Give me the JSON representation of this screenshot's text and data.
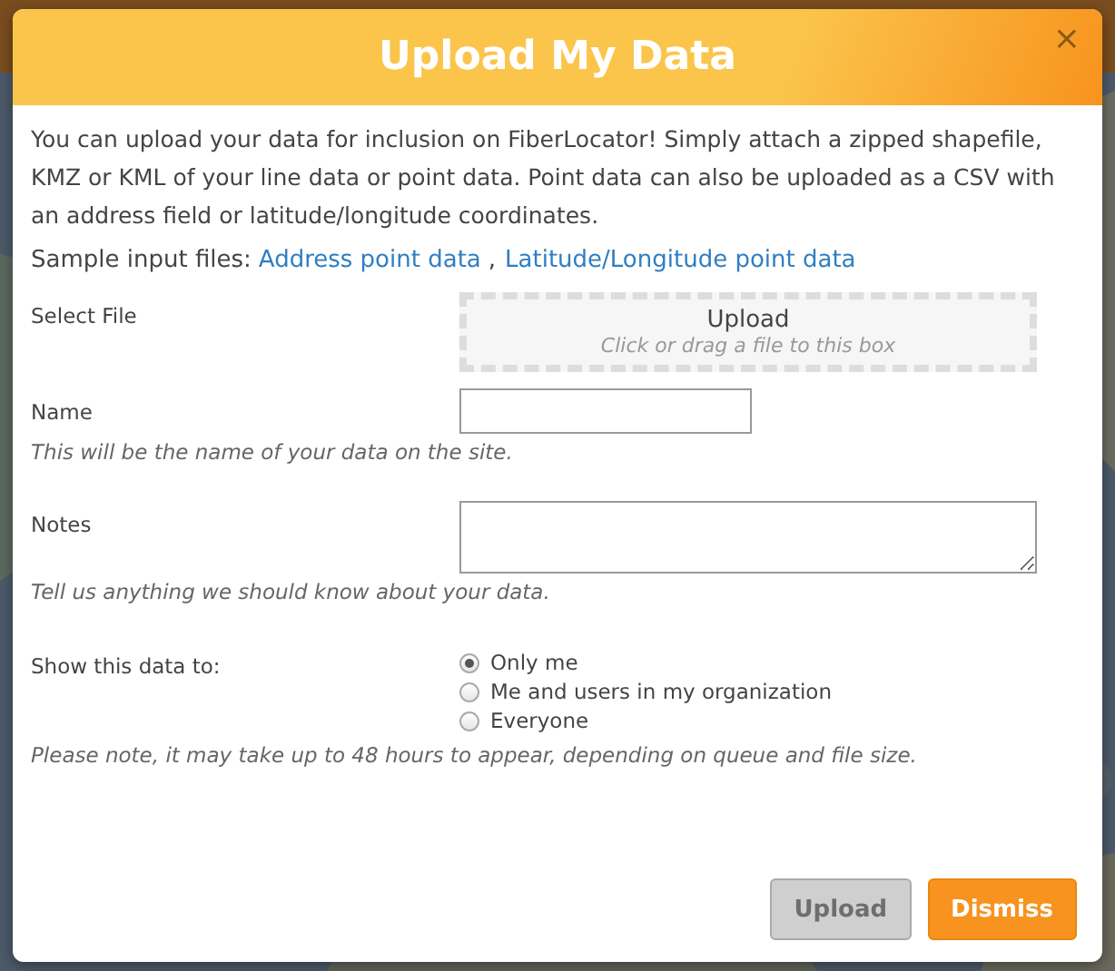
{
  "dialog": {
    "title": "Upload My Data",
    "close": "×"
  },
  "intro": "You can upload your data for inclusion on FiberLocator! Simply attach a zipped shapefile, KMZ or KML of your line data or point data. Point data can also be uploaded as a CSV with an address field or latitude/longitude coordinates.",
  "samples": {
    "label": "Sample input files:",
    "separator": ",",
    "links": [
      "Address point data",
      "Latitude/Longitude point data"
    ]
  },
  "file": {
    "label": "Select File",
    "title": "Upload",
    "hint": "Click or drag a file to this box"
  },
  "name": {
    "label": "Name",
    "help": "This will be the name of your data on the site."
  },
  "notes": {
    "label": "Notes",
    "help": "Tell us anything we should know about your data."
  },
  "visibility": {
    "label": "Show this data to:",
    "options": [
      {
        "label": "Only me",
        "selected": true
      },
      {
        "label": "Me and users in my organization",
        "selected": false
      },
      {
        "label": "Everyone",
        "selected": false
      }
    ]
  },
  "note": "Please note, it may take up to 48 hours to appear, depending on queue and file size.",
  "buttons": [
    {
      "label": "Upload",
      "kind": "secondary",
      "disabled": true
    },
    {
      "label": "Dismiss",
      "kind": "primary",
      "disabled": false
    }
  ]
}
